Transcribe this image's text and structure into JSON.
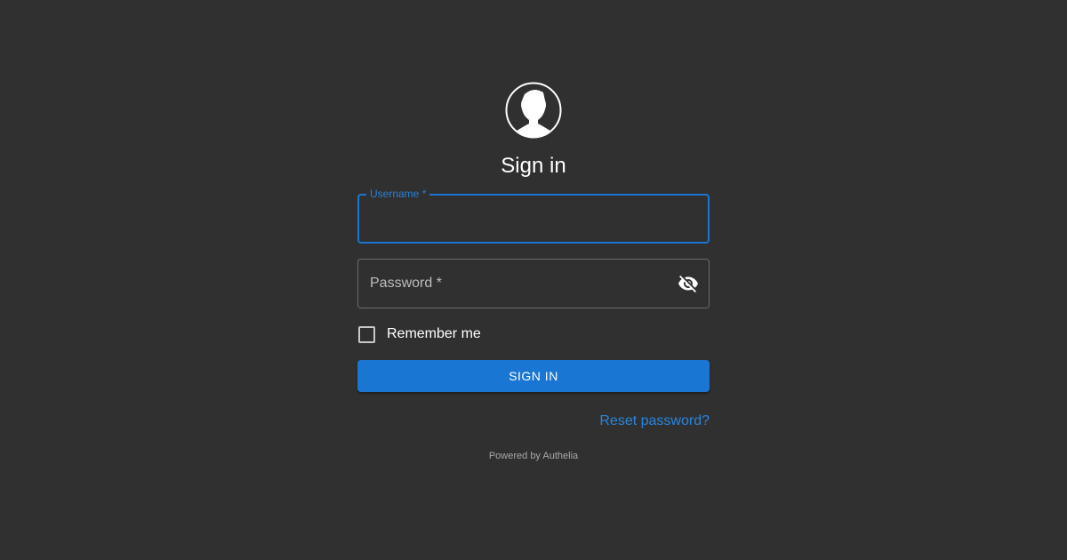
{
  "page": {
    "title": "Sign in",
    "avatar_icon": "user-avatar-icon"
  },
  "form": {
    "username": {
      "label": "Username *",
      "value": "",
      "placeholder": ""
    },
    "password": {
      "label": "Password *",
      "value": "",
      "visibility_icon": "eye-off-icon"
    },
    "remember_me": {
      "label": "Remember me",
      "checked": false
    },
    "submit_label": "SIGN IN",
    "reset_label": "Reset password?"
  },
  "footer": {
    "powered_by": "Powered by Authelia"
  },
  "colors": {
    "background": "#303030",
    "primary": "#1976d2",
    "link": "#2a85df",
    "text": "#ffffff"
  }
}
